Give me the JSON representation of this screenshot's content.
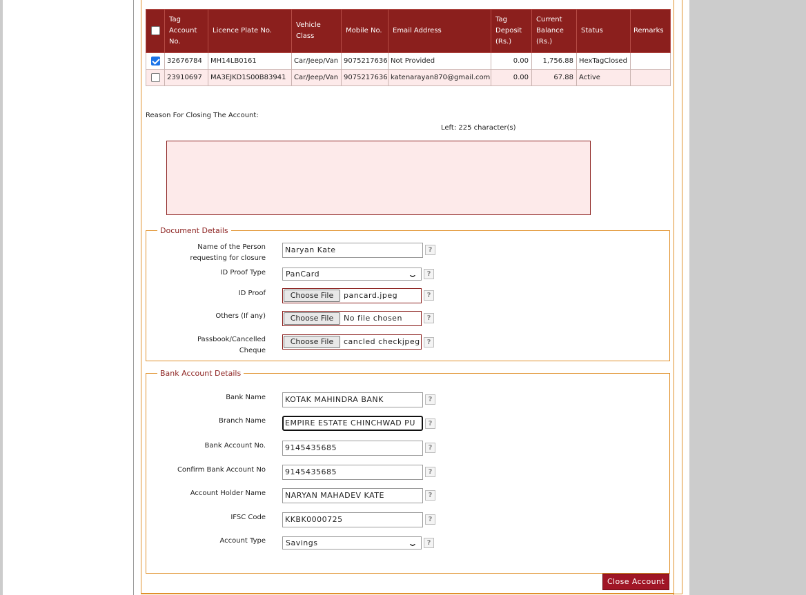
{
  "table": {
    "headers": {
      "tag_account": "Tag Account No.",
      "licence_plate": "Licence Plate No.",
      "vehicle_class": "Vehicle Class",
      "mobile": "Mobile No.",
      "email": "Email Address",
      "tag_deposit": "Tag Deposit (Rs.)",
      "current_balance": "Current Balance (Rs.)",
      "status": "Status",
      "remarks": "Remarks"
    },
    "rows": [
      {
        "checked": true,
        "tag_account": "32676784",
        "licence_plate": "MH14LB0161",
        "vehicle_class": "Car/Jeep/Van",
        "mobile": "9075217636",
        "email": "Not Provided",
        "tag_deposit": "0.00",
        "current_balance": "1,756.88",
        "status": "HexTagClosed",
        "remarks": ""
      },
      {
        "checked": false,
        "tag_account": "23910697",
        "licence_plate": "MA3EJKD1S00B83941",
        "vehicle_class": "Car/Jeep/Van",
        "mobile": "9075217636",
        "email": "katenarayan870@gmail.com",
        "tag_deposit": "0.00",
        "current_balance": "67.88",
        "status": "Active",
        "remarks": ""
      }
    ]
  },
  "reason": {
    "label": "Reason For Closing The Account:",
    "chars_left": "Left: 225 character(s)",
    "value": ""
  },
  "document_details": {
    "legend": "Document Details",
    "person_name_label_line1": "Name of the Person",
    "person_name_label_line2": "requesting for closure",
    "person_name_value": "Naryan Kate",
    "id_proof_type_label": "ID Proof Type",
    "id_proof_type_value": "PanCard",
    "id_proof_label": "ID Proof",
    "id_proof_file": "pancard.jpeg",
    "others_label": "Others (If any)",
    "others_file": "No file chosen",
    "passbook_label_line1": "Passbook/Cancelled",
    "passbook_label_line2": "Cheque",
    "passbook_file": "cancled checkjpeg",
    "choose_file_label": "Choose File"
  },
  "bank_details": {
    "legend": "Bank Account Details",
    "bank_name_label": "Bank Name",
    "bank_name_value": "KOTAK MAHINDRA BANK",
    "branch_name_label": "Branch Name",
    "branch_name_value": "EMPIRE ESTATE CHINCHWAD PU",
    "account_no_label": "Bank Account No.",
    "account_no_value": "9145435685",
    "confirm_account_label": "Confirm Bank Account No",
    "confirm_account_value": "9145435685",
    "holder_name_label": "Account Holder Name",
    "holder_name_value": "NARYAN MAHADEV KATE",
    "ifsc_label": "IFSC Code",
    "ifsc_value": "KKBK0000725",
    "account_type_label": "Account Type",
    "account_type_value": "Savings"
  },
  "help_glyph": "?",
  "close_button": "Close Account",
  "colors": {
    "header_bg": "#8b1f1d",
    "row_alt_bg": "#fdeaea",
    "border_orange": "#e0902a",
    "button_bg": "#a01626"
  }
}
